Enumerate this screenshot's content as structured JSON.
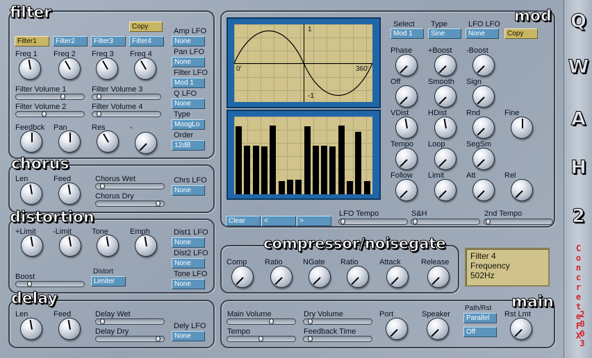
{
  "filter": {
    "title": "filter",
    "copy": "Copy",
    "buttons": [
      "Filter1",
      "Filter2",
      "Filter3",
      "Filter4"
    ],
    "freq": [
      "Freq 1",
      "Freq 2",
      "Freq 3",
      "Freq 4"
    ],
    "vol": [
      "Filter Volume 1",
      "Filter Volume 2",
      "Filter Volume 3",
      "Filter Volume 4"
    ],
    "bottom": [
      "Feedbck",
      "Pan",
      "Res",
      "-"
    ],
    "side_labels": [
      "Amp LFO",
      "Pan LFO",
      "Filter LFO",
      "Q LFO",
      "Type",
      "Order"
    ],
    "side_values": [
      "None",
      "None",
      "Mod 1",
      "None",
      "MoogLo",
      "12dB"
    ]
  },
  "chorus": {
    "title": "chorus",
    "len": "Len",
    "feed": "Feed",
    "wet": "Chorus Wet",
    "dry": "Chorus Dry",
    "lfo_label": "Chrs LFO",
    "lfo_value": "None"
  },
  "distortion": {
    "title": "distortion",
    "knobs": [
      "+Limit",
      "-Limit",
      "Tone",
      "Emph"
    ],
    "boost": "Boost",
    "distort_label": "Distort",
    "distort_value": "Limiter",
    "side_labels": [
      "Dist1 LFO",
      "Dist2 LFO",
      "Tone LFO"
    ],
    "side_values": [
      "None",
      "None",
      "None"
    ]
  },
  "delay": {
    "title": "delay",
    "len": "Len",
    "feed": "Feed",
    "wet": "Delay Wet",
    "dry": "Delay Dry",
    "lfo_label": "Dely LFO",
    "lfo_value": "None"
  },
  "mod": {
    "title": "mod",
    "wave_labels": {
      "top": "1",
      "left": "0'",
      "right": "360'",
      "bottom": "-1"
    },
    "select_labels": [
      "Select",
      "Type",
      "LFO LFO"
    ],
    "select_values": [
      "Mod 1",
      "Sine",
      "None"
    ],
    "copy": "Copy",
    "knobs": [
      "Phase",
      "+Boost",
      "-Boost",
      "Off",
      "Smooth",
      "Sign",
      "VDist",
      "HDist",
      "Rnd",
      "Fine",
      "Tempo",
      "Loop",
      "SegSm",
      "Follow",
      "Limit",
      "Att",
      "Rel"
    ],
    "clear": "Clear",
    "prev": "<",
    "next": ">",
    "lfo_tempo": "LFO Tempo",
    "sh": "S&H",
    "second_tempo": "2nd Tempo",
    "step_values": [
      0.92,
      0.66,
      0.66,
      0.65,
      0.93,
      0.18,
      0.2,
      0.2,
      0.92,
      0.66,
      0.66,
      0.65,
      0.93,
      0.18,
      0.85,
      0.18
    ]
  },
  "comp": {
    "title": "compressor/noisegate",
    "knobs": [
      "Comp",
      "Ratio",
      "NGate",
      "Ratio",
      "Attack",
      "Release"
    ]
  },
  "readout": {
    "line1": "Filter 4",
    "line2": "Frequency",
    "line3": "502Hz"
  },
  "main": {
    "title": "main",
    "main_volume": "Main Volume",
    "dry_volume": "Dry Volume",
    "tempo": "Tempo",
    "feedback_time": "Feedback Time",
    "port": "Port",
    "speaker": "Speaker",
    "path_label": "Path/Rst",
    "path_value": "Parallel",
    "rst_value": "Off",
    "rst_lmt": "Rst Lmt"
  },
  "brand": {
    "letters": [
      "Q",
      "W",
      "A",
      "H",
      "2"
    ],
    "vendor": "ConcreteFX",
    "year": "2003"
  }
}
